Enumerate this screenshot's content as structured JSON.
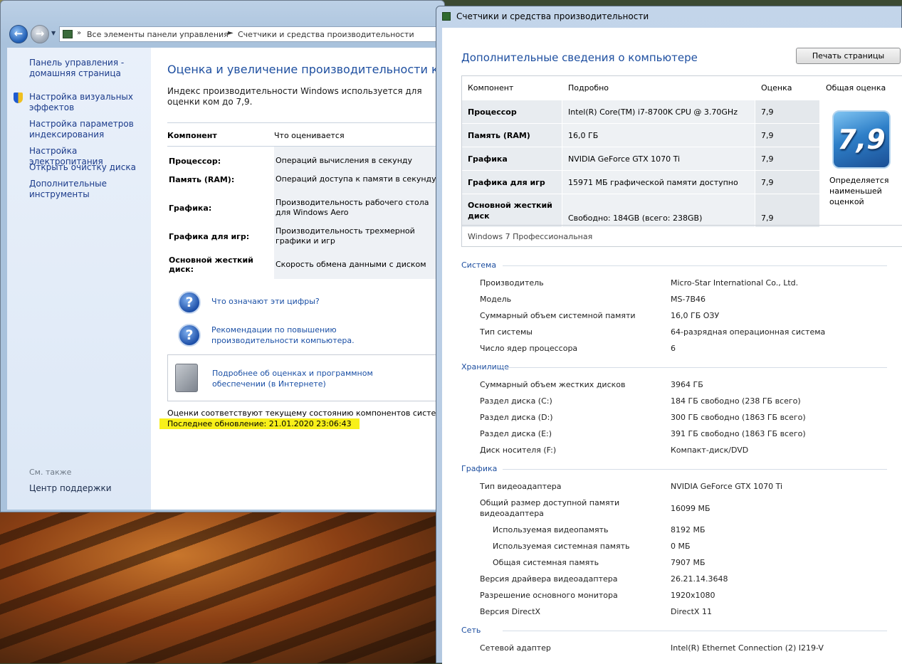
{
  "control_panel": {
    "breadcrumb": [
      "Все элементы панели управления",
      "Счетчики и средства производительности"
    ],
    "sidebar": {
      "home_link": "Панель управления - домашняя страница",
      "links": [
        "Настройка визуальных эффектов",
        "Настройка параметров индексирования",
        "Настройка электропитания",
        "Открыть очистку диска",
        "Дополнительные инструменты"
      ],
      "see_also_label": "См. также",
      "support_link": "Центр поддержки"
    },
    "main": {
      "title": "Оценка и увеличение производительности компьют",
      "description": "Индекс производительности Windows используется для оценки ком до 7,9.",
      "table_header": {
        "component": "Компонент",
        "rated": "Что оценивается"
      },
      "rows": [
        {
          "label": "Процессор:",
          "desc": "Операций вычисления в секунду"
        },
        {
          "label": "Память (RAM):",
          "desc": "Операций доступа к памяти в секунду"
        },
        {
          "label": "Графика:",
          "desc": "Производительность рабочего стола для Windows Aero"
        },
        {
          "label": "Графика для игр:",
          "desc": "Производительность трехмерной графики и игр"
        },
        {
          "label": "Основной жесткий диск:",
          "desc": "Скорость обмена данными с диском"
        }
      ],
      "help_links": [
        "Что означают эти цифры?",
        "Рекомендации по повышению производительности компьютера."
      ],
      "info_link": "Подробнее об оценках и программном обеспечении (в Интернете)",
      "status_text": "Оценки соответствуют текущему состоянию компонентов системы",
      "last_update": "Последнее обновление: 21.01.2020 23:06:43"
    }
  },
  "details_window": {
    "title": "Счетчики и средства производительности",
    "heading": "Дополнительные сведения о компьютере",
    "print_button": "Печать страницы",
    "score_table": {
      "headers": {
        "component": "Компонент",
        "details": "Подробно",
        "score": "Оценка",
        "base": "Общая оценка"
      },
      "rows": [
        {
          "component": "Процессор",
          "details": "Intel(R) Core(TM) i7-8700K CPU @ 3.70GHz",
          "score": "7,9"
        },
        {
          "component": "Память (RAM)",
          "details": "16,0 ГБ",
          "score": "7,9"
        },
        {
          "component": "Графика",
          "details": "NVIDIA GeForce GTX 1070 Ti",
          "score": "7,9"
        },
        {
          "component": "Графика для игр",
          "details": "15971 МБ графической памяти доступно",
          "score": "7,9"
        },
        {
          "component": "Основной жесткий диск",
          "details": "Свободно: 184GB (всего: 238GB)",
          "score": "7,9"
        }
      ],
      "base_score": "7,9",
      "base_note": "Определяется наименьшей оценкой",
      "os": "Windows 7 Профессиональная"
    },
    "sections": {
      "system": {
        "title": "Система",
        "items": [
          {
            "label": "Производитель",
            "value": "Micro-Star International Co., Ltd."
          },
          {
            "label": "Модель",
            "value": "MS-7B46"
          },
          {
            "label": "Суммарный объем системной памяти",
            "value": "16,0 ГБ ОЗУ"
          },
          {
            "label": "Тип системы",
            "value": "64-разрядная операционная система"
          },
          {
            "label": "Число ядер процессора",
            "value": "6"
          }
        ]
      },
      "storage": {
        "title": "Хранилище",
        "items": [
          {
            "label": "Суммарный объем жестких дисков",
            "value": "3964 ГБ"
          },
          {
            "label": "Раздел диска (C:)",
            "value": "184 ГБ свободно (238 ГБ всего)"
          },
          {
            "label": "Раздел диска (D:)",
            "value": "300 ГБ свободно (1863 ГБ всего)"
          },
          {
            "label": "Раздел диска (E:)",
            "value": "391 ГБ свободно (1863 ГБ всего)"
          },
          {
            "label": "Диск носителя (F:)",
            "value": "Компакт-диск/DVD"
          }
        ]
      },
      "graphics": {
        "title": "Графика",
        "items": [
          {
            "label": "Тип видеоадаптера",
            "value": "NVIDIA GeForce GTX 1070 Ti"
          },
          {
            "label": "Общий размер доступной памяти видеоадаптера",
            "value": "16099 МБ"
          },
          {
            "label": "Используемая видеопамять",
            "value": "8192 МБ"
          },
          {
            "label": "Используемая системная память",
            "value": "0 МБ"
          },
          {
            "label": "Общая системная память",
            "value": "7907 МБ"
          },
          {
            "label": "Версия драйвера видеоадаптера",
            "value": "26.21.14.3648"
          },
          {
            "label": "Разрешение основного монитора",
            "value": "1920x1080"
          },
          {
            "label": "Версия DirectX",
            "value": "DirectX 11"
          }
        ]
      },
      "network": {
        "title": "Сеть",
        "items": [
          {
            "label": "Сетевой адаптер",
            "value": "Intel(R) Ethernet Connection (2) I219-V"
          }
        ]
      }
    }
  }
}
